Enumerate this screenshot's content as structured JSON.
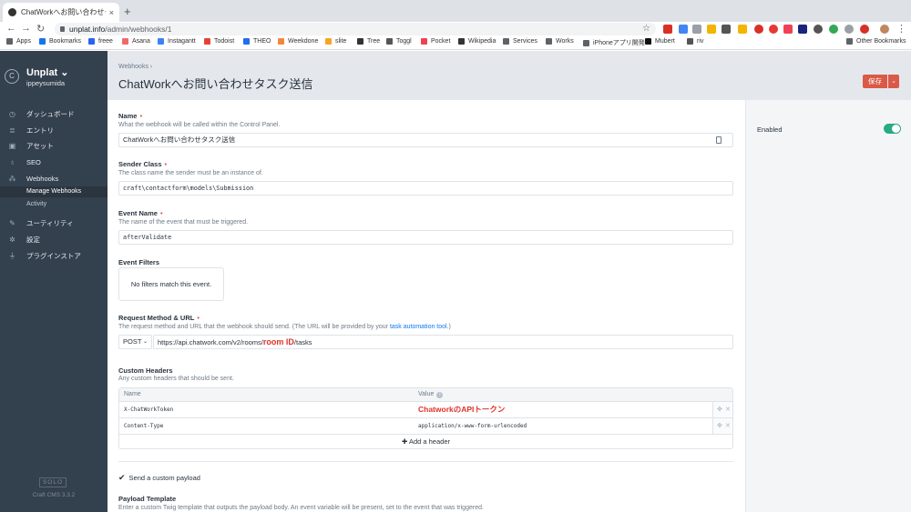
{
  "browser": {
    "tab_title": "ChatWorkへお問い合わせタスク送",
    "tab_close": "×",
    "new_tab": "+",
    "url_host": "unplat.info",
    "url_path": "/admin/webhooks/1",
    "bookmarks": [
      {
        "label": "Apps",
        "color": "#5f6368"
      },
      {
        "label": "Bookmarks",
        "color": "#1a73e8"
      },
      {
        "label": "freee",
        "color": "#2864f0"
      },
      {
        "label": "Asana",
        "color": "#f06a6a"
      },
      {
        "label": "Instagantt",
        "color": "#3b82f6"
      },
      {
        "label": "Todoist",
        "color": "#e44332"
      },
      {
        "label": "THEO",
        "color": "#1f6feb"
      },
      {
        "label": "Weekdone",
        "color": "#f0883e"
      },
      {
        "label": "slite",
        "color": "#f5a623"
      },
      {
        "label": "Tree",
        "color": "#333333"
      },
      {
        "label": "Toggl",
        "color": "#555555"
      },
      {
        "label": "Pocket",
        "color": "#ef4056"
      },
      {
        "label": "Wikipedia",
        "color": "#333333"
      },
      {
        "label": "Services",
        "color": "#5f6368"
      },
      {
        "label": "Works",
        "color": "#5f6368"
      },
      {
        "label": "iPhoneアプリ開発",
        "color": "#5f6368"
      },
      {
        "label": "Mubert",
        "color": "#111111"
      },
      {
        "label": "riv",
        "color": "#555555"
      }
    ],
    "other_bookmarks": "Other Bookmarks"
  },
  "sidebar": {
    "site_name": "Unplat",
    "user": "ippeysumida",
    "items": [
      {
        "label": "ダッシュボード",
        "icon": "dashboard-icon"
      },
      {
        "label": "エントリ",
        "icon": "entries-icon"
      },
      {
        "label": "アセット",
        "icon": "assets-icon"
      },
      {
        "label": "SEO",
        "icon": "seo-icon"
      },
      {
        "label": "Webhooks",
        "icon": "webhooks-icon"
      },
      {
        "label": "ユーティリティ",
        "icon": "utilities-icon"
      },
      {
        "label": "設定",
        "icon": "settings-icon"
      },
      {
        "label": "プラグインストア",
        "icon": "plugin-store-icon"
      }
    ],
    "subitems": [
      {
        "label": "Manage Webhooks"
      },
      {
        "label": "Activity"
      }
    ],
    "edition": "SOLO",
    "version": "Craft CMS 3.3.2"
  },
  "header": {
    "breadcrumb": "Webhooks",
    "breadcrumb_sep": "›",
    "title": "ChatWorkへお問い合わせタスク送信",
    "save_label": "保存"
  },
  "right_pane": {
    "enabled_label": "Enabled",
    "enabled": true
  },
  "fields": {
    "name": {
      "label": "Name",
      "help": "What the webhook will be called within the Control Panel.",
      "value": "ChatWorkへお問い合わせタスク送信"
    },
    "sender_class": {
      "label": "Sender Class",
      "help": "The class name the sender must be an instance of.",
      "value": "craft\\contactform\\models\\Submission"
    },
    "event_name": {
      "label": "Event Name",
      "help": "The name of the event that must be triggered.",
      "value": "afterValidate"
    },
    "event_filters": {
      "label": "Event Filters",
      "empty": "No filters match this event."
    },
    "request": {
      "label": "Request Method & URL",
      "help": "The request method and URL that the webhook should send. (The URL will be provided by your ",
      "help_link": "task automation tool",
      "help_end": ".)",
      "method": "POST",
      "url_start": "https://api.chatwork.com/v2/rooms/",
      "url_highlight": "room ID",
      "url_end": "/tasks"
    },
    "custom_headers": {
      "label": "Custom Headers",
      "help": "Any custom headers that should be sent.",
      "col_name": "Name",
      "col_value": "Value",
      "rows": [
        {
          "name": "X-ChatWorkToken",
          "value": "ChatworkのAPIトークン"
        },
        {
          "name": "Content-Type",
          "value": "application/x-www-form-urlencoded"
        }
      ],
      "add_label": "Add a header"
    },
    "custom_payload": {
      "label": "Send a custom payload",
      "checked": true
    },
    "payload_template": {
      "label": "Payload Template",
      "help": "Enter a custom Twig template that outputs the payload body. An event variable will be present, set to the event that was triggered."
    }
  }
}
